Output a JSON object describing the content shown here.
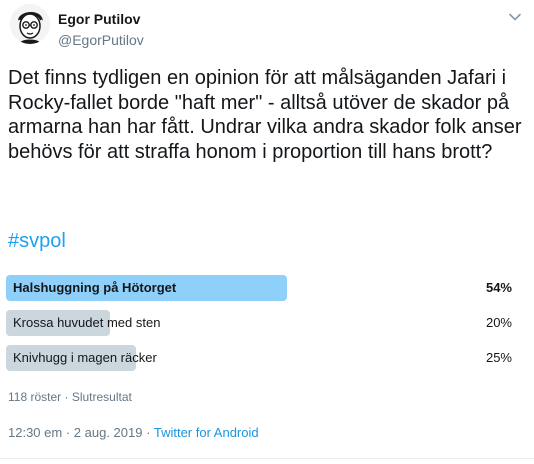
{
  "author": {
    "display_name": "Egor Putilov",
    "handle": "@EgorPutilov",
    "avatar_icon": "cartoon-portrait-avatar"
  },
  "tweet": {
    "text": "Det finns tydligen en opinion för att målsäganden Jafari i Rocky-fallet borde \"haft mer\" - alltså utöver de skador på armarna han har fått. Undrar vilka andra skador folk anser behövs för att straffa honom i proportion till hans brott?",
    "hashtag": "#svpol"
  },
  "poll": {
    "options": [
      {
        "label": "Halshuggning på Hötorget",
        "percent_label": "54%",
        "share": 0.54,
        "winner": true
      },
      {
        "label": "Krossa huvudet med sten",
        "percent_label": "20%",
        "share": 0.2,
        "winner": false
      },
      {
        "label": "Knivhugg i magen räcker",
        "percent_label": "25%",
        "share": 0.25,
        "winner": false
      }
    ],
    "votes": "118 röster",
    "separator": "·",
    "status": "Slutresultat"
  },
  "meta": {
    "time": "12:30 em",
    "separator": "·",
    "date": "2 aug. 2019",
    "source": "Twitter for Android"
  },
  "colors": {
    "winner_bar": "#8ed0f9",
    "other_bar": "#ccd6dd",
    "link": "#1da1f2",
    "secondary_text": "#657786"
  }
}
